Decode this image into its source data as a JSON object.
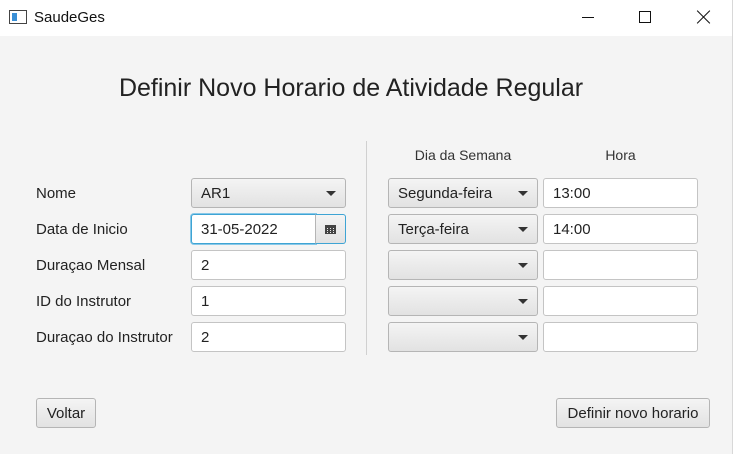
{
  "window": {
    "title": "SaudeGes"
  },
  "page": {
    "heading": "Definir Novo Horario de Atividade Regular"
  },
  "schedule": {
    "dia_header": "Dia da Semana",
    "hora_header": "Hora",
    "rows": [
      {
        "day": "Segunda-feira",
        "time": "13:00"
      },
      {
        "day": "Terça-feira",
        "time": "14:00"
      },
      {
        "day": "",
        "time": ""
      },
      {
        "day": "",
        "time": ""
      },
      {
        "day": "",
        "time": ""
      }
    ]
  },
  "form": {
    "nome": {
      "label": "Nome",
      "value": "AR1"
    },
    "data_inicio": {
      "label": "Data de Inicio",
      "value": "31-05-2022"
    },
    "duracao_mensal": {
      "label": "Duraçao Mensal",
      "value": "2"
    },
    "id_instrutor": {
      "label": "ID do Instrutor",
      "value": "1"
    },
    "duracao_instrutor": {
      "label": "Duraçao do Instrutor",
      "value": "2"
    }
  },
  "buttons": {
    "voltar": "Voltar",
    "definir": "Definir novo horario"
  },
  "icons": {
    "app": "app-window-icon",
    "calendar": "calendar-icon",
    "dropdown": "chevron-down-icon"
  }
}
